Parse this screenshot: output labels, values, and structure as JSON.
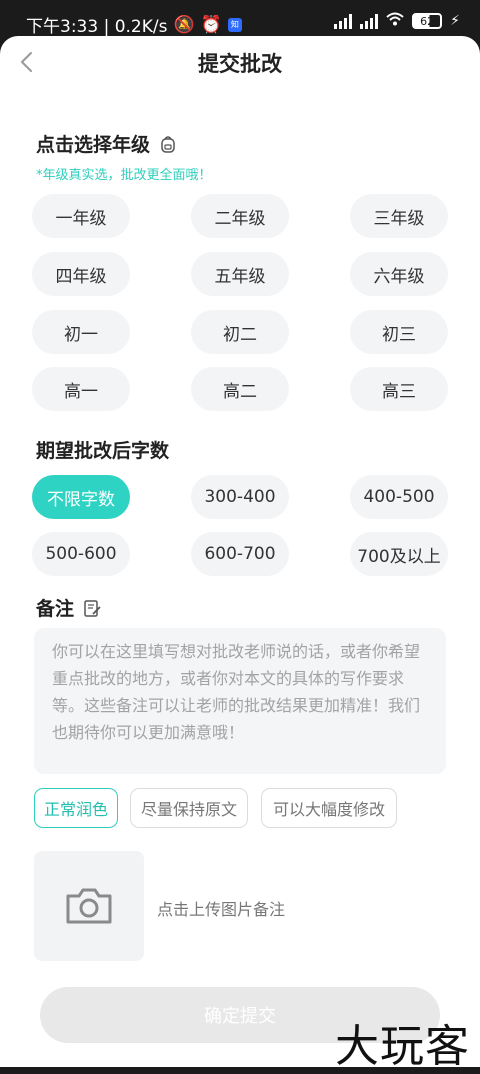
{
  "status": {
    "time_speed": "下午3:33 | 0.2K/s",
    "battery": "62"
  },
  "header": {
    "title": "提交批改"
  },
  "grade": {
    "title": "点击选择年级",
    "hint": "*年级真实选，批改更全面哦！",
    "options": [
      "一年级",
      "二年级",
      "三年级",
      "四年级",
      "五年级",
      "六年级",
      "初一",
      "初二",
      "初三",
      "高一",
      "高二",
      "高三"
    ]
  },
  "wordcount": {
    "title": "期望批改后字数",
    "options": [
      "不限字数",
      "300-400",
      "400-500",
      "500-600",
      "600-700",
      "700及以上"
    ],
    "selected": "不限字数"
  },
  "note": {
    "title": "备注",
    "placeholder": "你可以在这里填写想对批改老师说的话，或者你希望重点批改的地方，或者你对本文的具体的写作要求等。这些备注可以让老师的批改结果更加精准！我们也期待你可以更加满意哦！"
  },
  "style_tags": {
    "options": [
      "正常润色",
      "尽量保持原文",
      "可以大幅度修改"
    ],
    "selected": "正常润色"
  },
  "upload": {
    "label": "点击上传图片备注"
  },
  "submit": {
    "label": "确定提交"
  },
  "watermark": "大玩客",
  "colors": {
    "accent": "#2ed3c3",
    "disabled": "#e8e8e8"
  }
}
